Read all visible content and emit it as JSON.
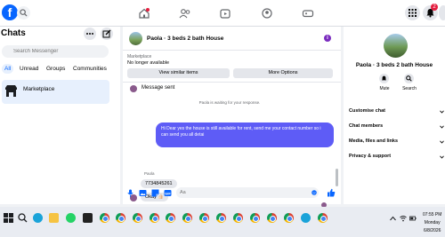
{
  "chats_panel": {
    "title": "Chats",
    "search_placeholder": "Search Messenger",
    "filters": [
      "All",
      "Unread",
      "Groups",
      "Communities"
    ],
    "marketplace_label": "Marketplace"
  },
  "conversation": {
    "title": "Paola · 3 beds 2 bath House",
    "marketplace_caption": "Marketplace",
    "availability": "No longer available",
    "view_similar_label": "View similar items",
    "more_options_label": "More Options",
    "message_sent": "Message sent",
    "waiting_text": "Paola is waiting for your response.",
    "outgoing_message": "Hi Dear yes the house is still available for rent, send me your contact number so i can send you all detai",
    "sender_name": "Paola",
    "incoming_messages": [
      "7734845261",
      "Okay 👍🏻"
    ],
    "composer_placeholder": "Aa"
  },
  "details_panel": {
    "title": "Paola · 3 beds 2 bath House",
    "mute_label": "Mute",
    "search_label": "Search",
    "sections": [
      "Customise chat",
      "Chat members",
      "Media, files and links",
      "Privacy & support"
    ]
  },
  "header": {
    "notification_badge": "2"
  },
  "taskbar": {
    "time": "07:55 PM",
    "day": "Monday",
    "date": "6/8/2026"
  },
  "colors": {
    "brand": "#0866ff",
    "bubble": "#5e5cf6"
  }
}
